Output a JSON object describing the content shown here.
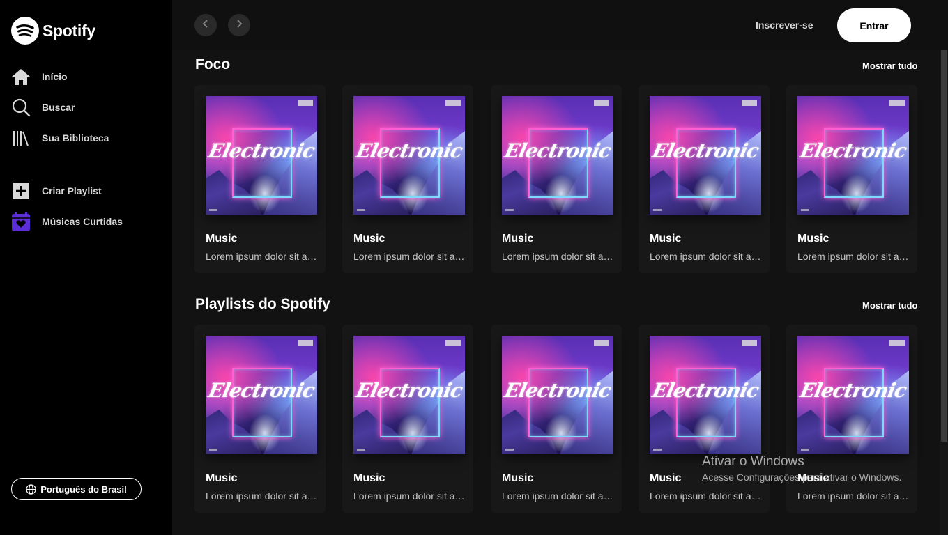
{
  "app": {
    "name": "Spotify"
  },
  "sidebar": {
    "items": [
      {
        "label": "Início",
        "icon": "home-icon"
      },
      {
        "label": "Buscar",
        "icon": "search-icon"
      },
      {
        "label": "Sua Biblioteca",
        "icon": "library-icon"
      },
      {
        "label": "Criar Playlist",
        "icon": "plus-square-icon"
      },
      {
        "label": "Músicas Curtidas",
        "icon": "heart-calendar-icon"
      }
    ],
    "language_button": "Português do Brasil"
  },
  "header": {
    "signup_label": "Inscrever-se",
    "login_label": "Entrar"
  },
  "sections": [
    {
      "title": "Foco",
      "show_all": "Mostrar tudo",
      "cards": [
        {
          "title": "Music",
          "description": "Lorem ipsum dolor sit amet consectetur",
          "art_text": "Electronic"
        },
        {
          "title": "Music",
          "description": "Lorem ipsum dolor sit amet consectetur",
          "art_text": "Electronic"
        },
        {
          "title": "Music",
          "description": "Lorem ipsum dolor sit amet consectetur",
          "art_text": "Electronic"
        },
        {
          "title": "Music",
          "description": "Lorem ipsum dolor sit amet consectetur",
          "art_text": "Electronic"
        },
        {
          "title": "Music",
          "description": "Lorem ipsum dolor sit amet consectetur",
          "art_text": "Electronic"
        }
      ]
    },
    {
      "title": "Playlists do Spotify",
      "show_all": "Mostrar tudo",
      "cards": [
        {
          "title": "Music",
          "description": "Lorem ipsum dolor sit amet consectetur",
          "art_text": "Electronic"
        },
        {
          "title": "Music",
          "description": "Lorem ipsum dolor sit amet consectetur",
          "art_text": "Electronic"
        },
        {
          "title": "Music",
          "description": "Lorem ipsum dolor sit amet consectetur",
          "art_text": "Electronic"
        },
        {
          "title": "Music",
          "description": "Lorem ipsum dolor sit amet consectetur",
          "art_text": "Electronic"
        },
        {
          "title": "Music",
          "description": "Lorem ipsum dolor sit amet consectetur",
          "art_text": "Electronic"
        }
      ]
    }
  ],
  "watermark": {
    "title": "Ativar o Windows",
    "subtitle": "Acesse Configurações para ativar o Windows."
  },
  "colors": {
    "sidebar_bg": "#000000",
    "main_bg": "#121212",
    "card_bg": "#181818",
    "liked_accent": "#5b2ed8"
  }
}
